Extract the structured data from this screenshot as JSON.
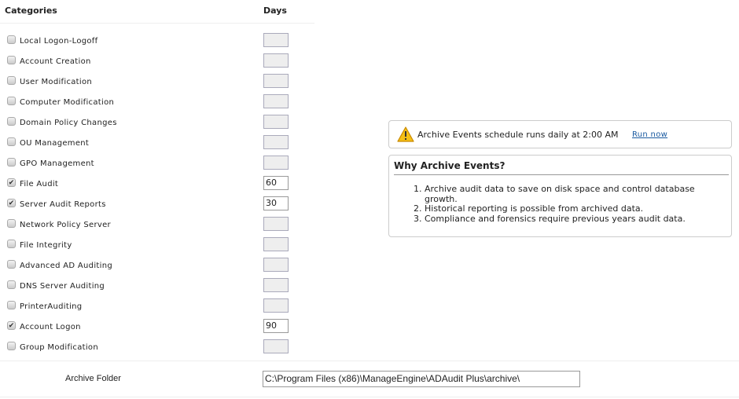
{
  "headers": {
    "categories": "Categories",
    "days": "Days"
  },
  "categories": [
    {
      "label": "Local Logon-Logoff",
      "checked": false,
      "days": ""
    },
    {
      "label": "Account Creation",
      "checked": false,
      "days": ""
    },
    {
      "label": "User Modification",
      "checked": false,
      "days": ""
    },
    {
      "label": "Computer Modification",
      "checked": false,
      "days": ""
    },
    {
      "label": "Domain Policy Changes",
      "checked": false,
      "days": ""
    },
    {
      "label": "OU Management",
      "checked": false,
      "days": ""
    },
    {
      "label": "GPO Management",
      "checked": false,
      "days": ""
    },
    {
      "label": "File Audit",
      "checked": true,
      "days": "60"
    },
    {
      "label": "Server Audit Reports",
      "checked": true,
      "days": "30"
    },
    {
      "label": "Network Policy Server",
      "checked": false,
      "days": ""
    },
    {
      "label": "File Integrity",
      "checked": false,
      "days": ""
    },
    {
      "label": "Advanced AD Auditing",
      "checked": false,
      "days": ""
    },
    {
      "label": "DNS Server Auditing",
      "checked": false,
      "days": ""
    },
    {
      "label": "PrinterAuditing",
      "checked": false,
      "days": ""
    },
    {
      "label": "Account Logon",
      "checked": true,
      "days": "90"
    },
    {
      "label": "Group Modification",
      "checked": false,
      "days": ""
    }
  ],
  "archive_folder": {
    "label": "Archive Folder",
    "value": "C:\\Program Files (x86)\\ManageEngine\\ADAudit Plus\\archive\\"
  },
  "schedule": {
    "icon": "warning-icon",
    "text": "Archive Events schedule runs daily at 2:00 AM",
    "run_now": "Run now"
  },
  "why": {
    "title": "Why Archive Events?",
    "items": [
      "Archive audit data to save on disk space and control database growth.",
      "Historical reporting is possible from archived data.",
      "Compliance and forensics require previous years audit data."
    ]
  }
}
